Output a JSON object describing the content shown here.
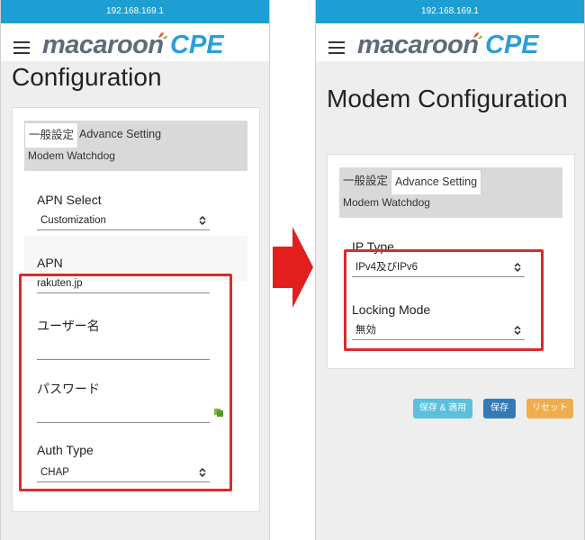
{
  "left": {
    "status_ip": "192.168.169.1",
    "logo": {
      "main": "macaroon",
      "cpe": "CPE"
    },
    "page_title": "Configuration",
    "tabs": {
      "general": "一般設定",
      "advance": "Advance Setting",
      "watchdog": "Modem Watchdog"
    },
    "fields": {
      "apn_select_label": "APN Select",
      "apn_select_value": "Customization",
      "apn_label": "APN",
      "apn_value": "rakuten.jp",
      "username_label": "ユーザー名",
      "username_value": "",
      "password_label": "パスワード",
      "password_value": "",
      "auth_type_label": "Auth Type",
      "auth_type_value": "CHAP"
    }
  },
  "right": {
    "status_ip": "192.168.169.1",
    "logo": {
      "main": "macaroon",
      "cpe": "CPE"
    },
    "page_title": "Modem Configuration",
    "tabs": {
      "general": "一般設定",
      "advance": "Advance Setting",
      "watchdog": "Modem Watchdog"
    },
    "fields": {
      "ip_type_label": "IP Type",
      "ip_type_value": "IPv4及びIPv6",
      "locking_mode_label": "Locking Mode",
      "locking_mode_value": "無効"
    },
    "buttons": {
      "save_apply": "保存 & 適用",
      "save": "保存",
      "reset": "リセット"
    }
  },
  "colors": {
    "statusbar": "#1e9fd3",
    "highlight": "#dc2a2a",
    "btn_save_apply": "#5bc0de",
    "btn_save": "#337ab7",
    "btn_reset": "#f0ad4e"
  },
  "icons": [
    "hamburger-icon",
    "logo-leaf-icon",
    "select-arrows-icon",
    "password-eye-icon",
    "right-arrow-icon"
  ]
}
